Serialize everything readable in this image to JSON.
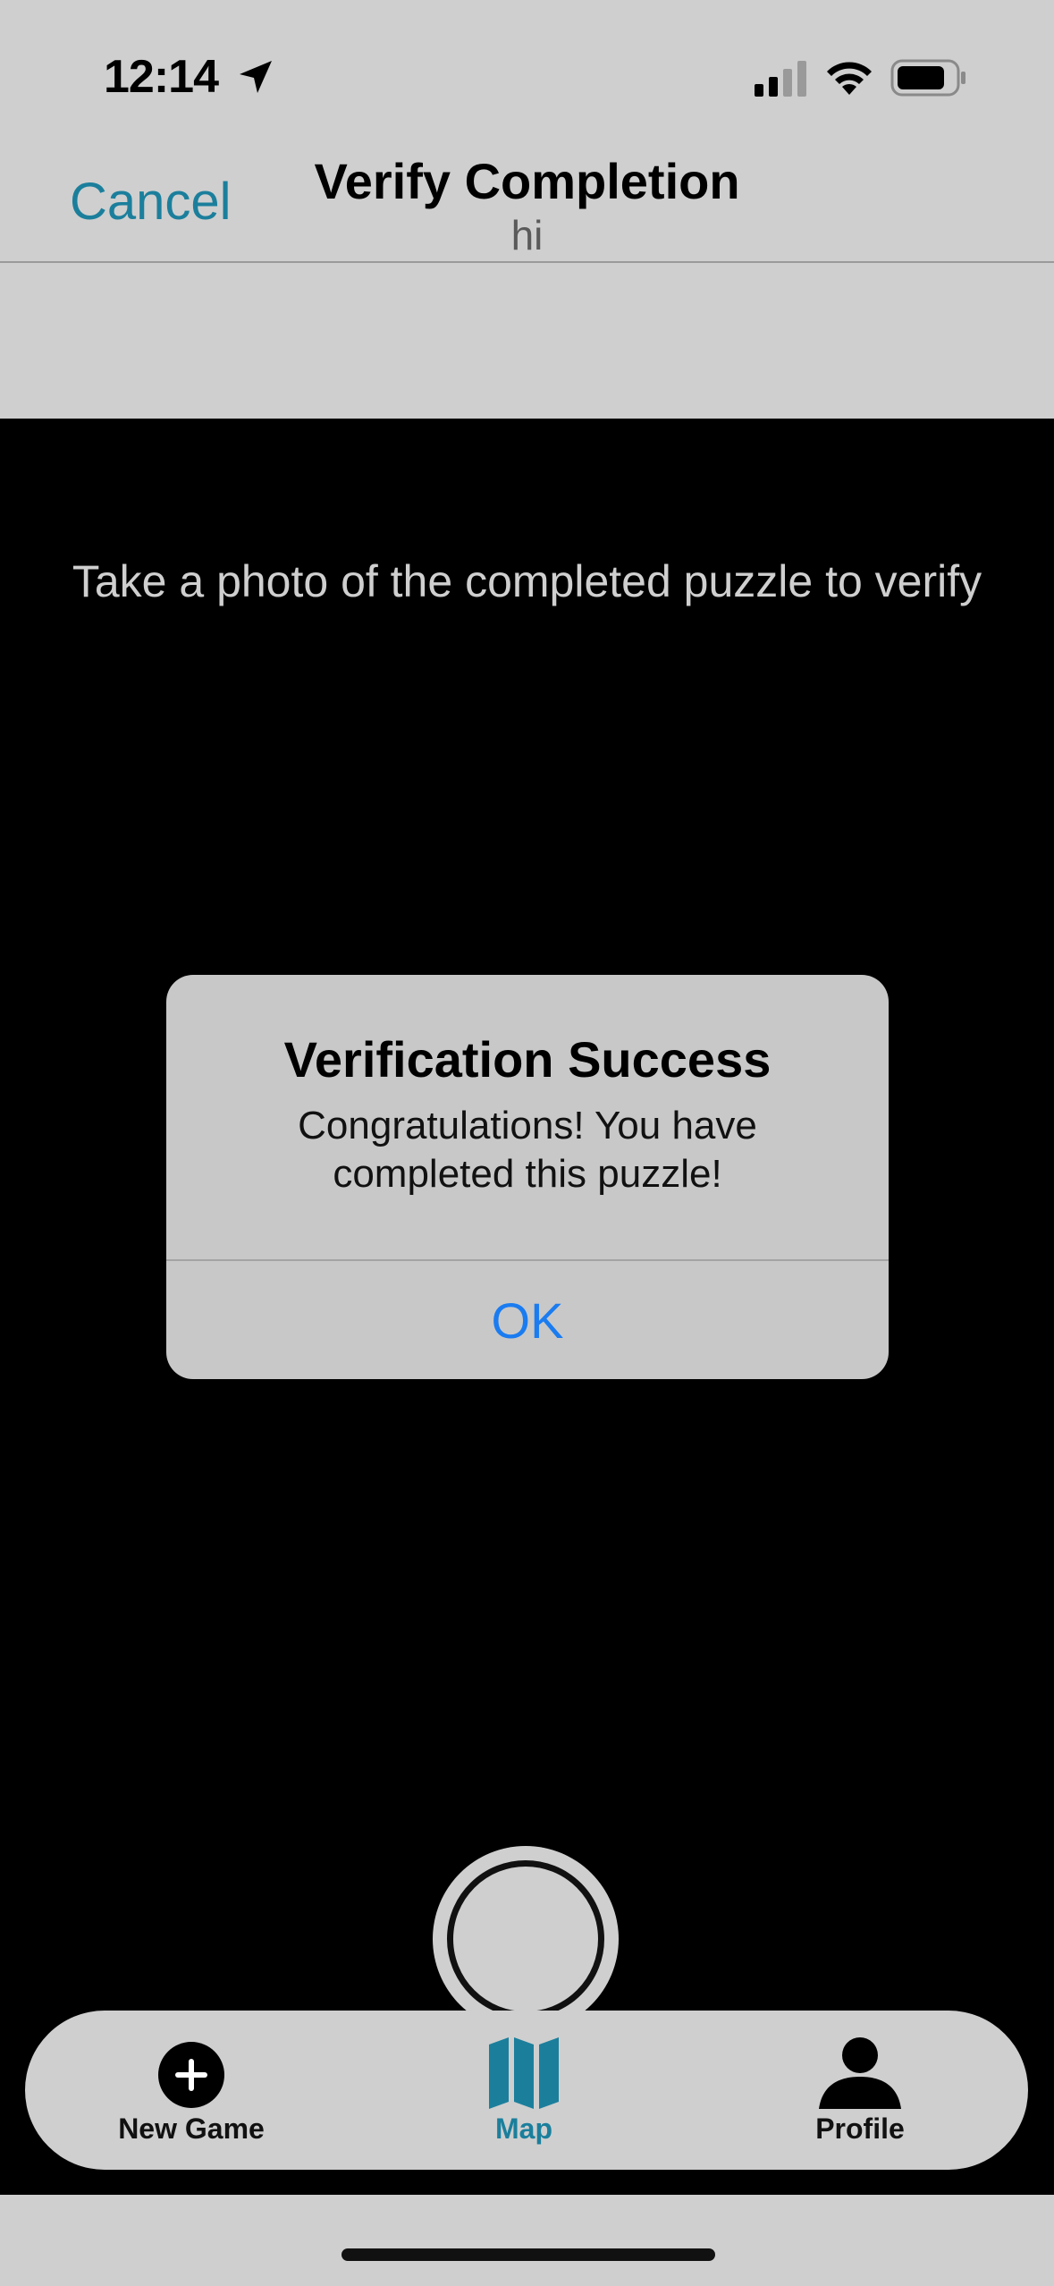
{
  "status_bar": {
    "time": "12:14",
    "icons": [
      "location-arrow-icon",
      "cellular-signal-icon",
      "wifi-icon",
      "battery-icon"
    ]
  },
  "nav": {
    "cancel_label": "Cancel",
    "title": "Verify Completion",
    "subtitle": "hi"
  },
  "camera": {
    "instructions": "Take a photo of the completed puzzle to verify",
    "shutter_icon": "camera-shutter"
  },
  "alert": {
    "title": "Verification Success",
    "message": "Congratulations! You have completed this puzzle!",
    "ok_label": "OK"
  },
  "tabs": [
    {
      "label": "New Game",
      "icon": "plus-circle-icon",
      "active": false
    },
    {
      "label": "Map",
      "icon": "map-icon",
      "active": true
    },
    {
      "label": "Profile",
      "icon": "person-icon",
      "active": false
    }
  ],
  "colors": {
    "accent": "#1b7f9c",
    "alert_action": "#1a7cf0",
    "background": "#cfcfcf",
    "camera": "#000000"
  }
}
